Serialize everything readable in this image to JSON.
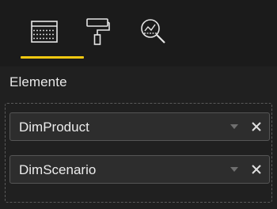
{
  "tabs": [
    {
      "name": "fields",
      "icon": "fields-table-icon",
      "active": true
    },
    {
      "name": "format",
      "icon": "paint-roller-icon",
      "active": false
    },
    {
      "name": "analytics",
      "icon": "analytics-magnifier-icon",
      "active": false
    }
  ],
  "colors": {
    "background": "#202020",
    "tabbar": "#1b1b1b",
    "active_indicator": "#f2c811",
    "field_background": "#2d2d2d",
    "text": "#e8e8e8"
  },
  "section": {
    "title": "Elemente"
  },
  "fields": [
    {
      "label": "DimProduct",
      "dropdown_icon": "chevron-down-icon",
      "remove_icon": "close-icon"
    },
    {
      "label": "DimScenario",
      "dropdown_icon": "chevron-down-icon",
      "remove_icon": "close-icon"
    }
  ]
}
